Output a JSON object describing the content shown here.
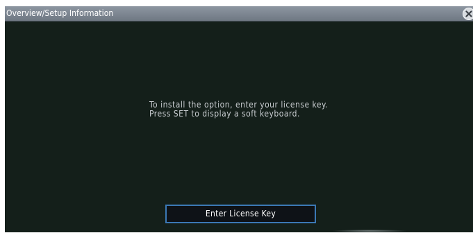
{
  "dialog": {
    "title": "Overview/Setup Information",
    "close_icon": "close-icon",
    "message_line1": "To install the option, enter your license key.",
    "message_line2": "Press SET to display a soft keyboard.",
    "button_label": "Enter License Key"
  },
  "colors": {
    "background": "#141f1a",
    "title_bar": "#7f8893",
    "button_border": "#3b78b5",
    "text": "#c8ccd0"
  }
}
